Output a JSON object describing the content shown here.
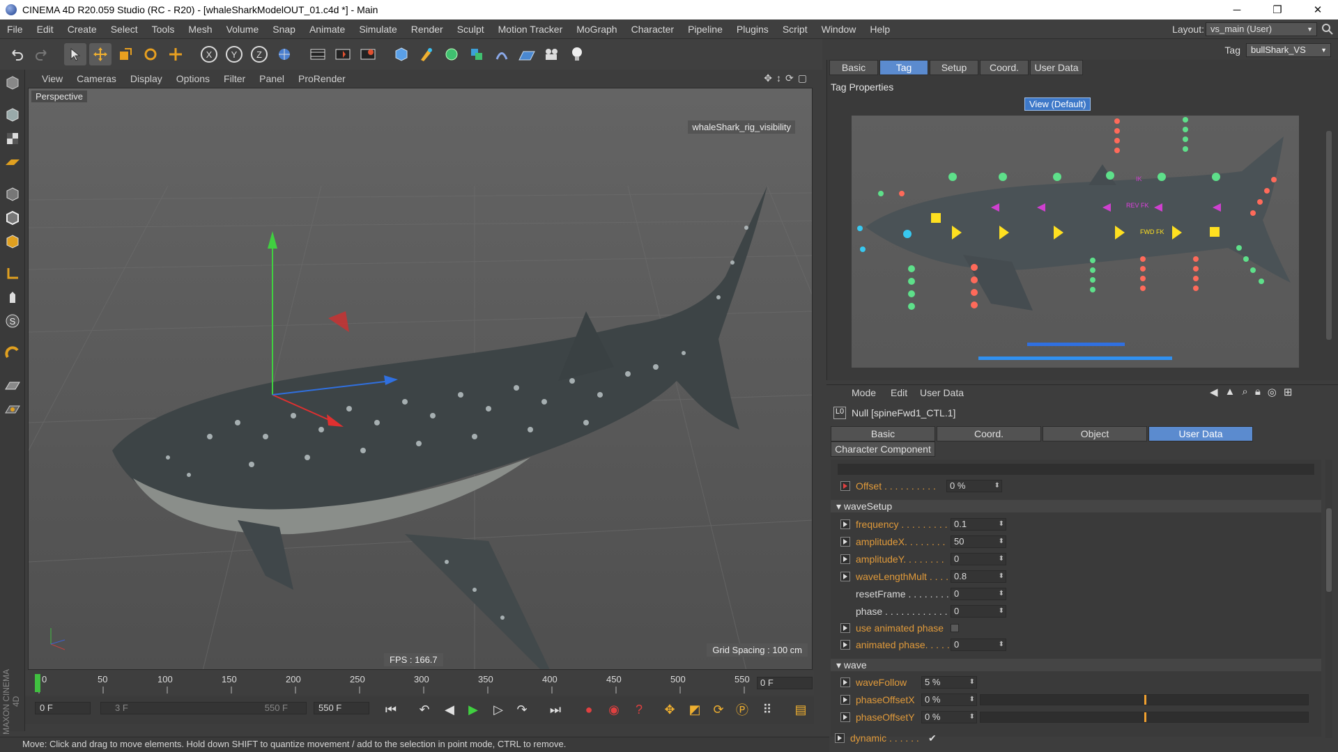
{
  "window": {
    "title": "CINEMA 4D R20.059 Studio (RC - R20) - [whaleSharkModelOUT_01.c4d *] - Main",
    "minimize": "─",
    "maximize": "❐",
    "close": "✕"
  },
  "menubar": {
    "items": [
      "File",
      "Edit",
      "Create",
      "Select",
      "Tools",
      "Mesh",
      "Volume",
      "Snap",
      "Animate",
      "Simulate",
      "Render",
      "Sculpt",
      "Motion Tracker",
      "MoGraph",
      "Character",
      "Pipeline",
      "Plugins",
      "Script",
      "Window",
      "Help"
    ],
    "layout_label": "Layout:",
    "layout_value": "vs_main (User)"
  },
  "toolbar": {
    "axis_x": "X",
    "axis_y": "Y",
    "axis_z": "Z"
  },
  "viewport": {
    "menu": [
      "View",
      "Cameras",
      "Display",
      "Options",
      "Filter",
      "Panel",
      "ProRender"
    ],
    "label": "Perspective",
    "visibility_tag": "whaleShark_rig_visibility",
    "fps": "FPS : 166.7",
    "grid_spacing": "Grid Spacing : 100 cm"
  },
  "timeline": {
    "ticks": [
      "0",
      "50",
      "100",
      "150",
      "200",
      "250",
      "300",
      "350",
      "400",
      "450",
      "500",
      "550"
    ],
    "current_frame": "0 F"
  },
  "playback": {
    "start_frame": "0 F",
    "range_start": "3 F",
    "range_end": "550 F",
    "end_frame": "550 F"
  },
  "statusbar": {
    "text": "Move: Click and drag to move elements. Hold down SHIFT to quantize movement / add to the selection in point mode, CTRL to remove.",
    "logo": "MAXON CINEMA 4D"
  },
  "right_top": {
    "tag_label": "Tag",
    "tag_value": "bullShark_VS",
    "tabs": [
      "Basic",
      "Tag",
      "Setup",
      "Coord.",
      "User Data"
    ],
    "active_tab": "Tag",
    "properties_title": "Tag Properties",
    "view_button": "View (Default)",
    "picker_labels": {
      "rev": "REV FK",
      "fwd": "FWD FK",
      "ik": "IK"
    }
  },
  "attribute_manager": {
    "menu": [
      "Mode",
      "Edit",
      "User Data"
    ],
    "object_title": "Null [spineFwd1_CTL.1]",
    "tabs": [
      "Basic",
      "Coord.",
      "Object",
      "User Data"
    ],
    "active_tab": "User Data",
    "sub_tab": "Character Component",
    "offset": {
      "label": "Offset . . . . . . . . . .",
      "value": "0 %"
    },
    "sections": {
      "waveSetup": "waveSetup",
      "wave": "wave"
    },
    "wave_setup_params": [
      {
        "label": "frequency . . . . . . . . .",
        "value": "0.1"
      },
      {
        "label": "amplitudeX. . . . . . . .",
        "value": "50"
      },
      {
        "label": "amplitudeY. . . . . . . .",
        "value": "0"
      },
      {
        "label": "waveLengthMult . . . .",
        "value": "0.8"
      },
      {
        "label": "resetFrame . . . . . . . .",
        "value": "0"
      },
      {
        "label": "phase . . . . . . . . . . . .",
        "value": "0"
      },
      {
        "label": "use animated phase",
        "value": ""
      },
      {
        "label": "animated phase. . . . .",
        "value": "0"
      }
    ],
    "wave_params": [
      {
        "label": "waveFollow",
        "value": "5 %"
      },
      {
        "label": "phaseOffsetX",
        "value": "0 %",
        "slider": 0.5
      },
      {
        "label": "phaseOffsetY",
        "value": "0 %",
        "slider": 0.5
      },
      {
        "label": "dynamic . . . . . .",
        "value": "✔"
      }
    ]
  }
}
